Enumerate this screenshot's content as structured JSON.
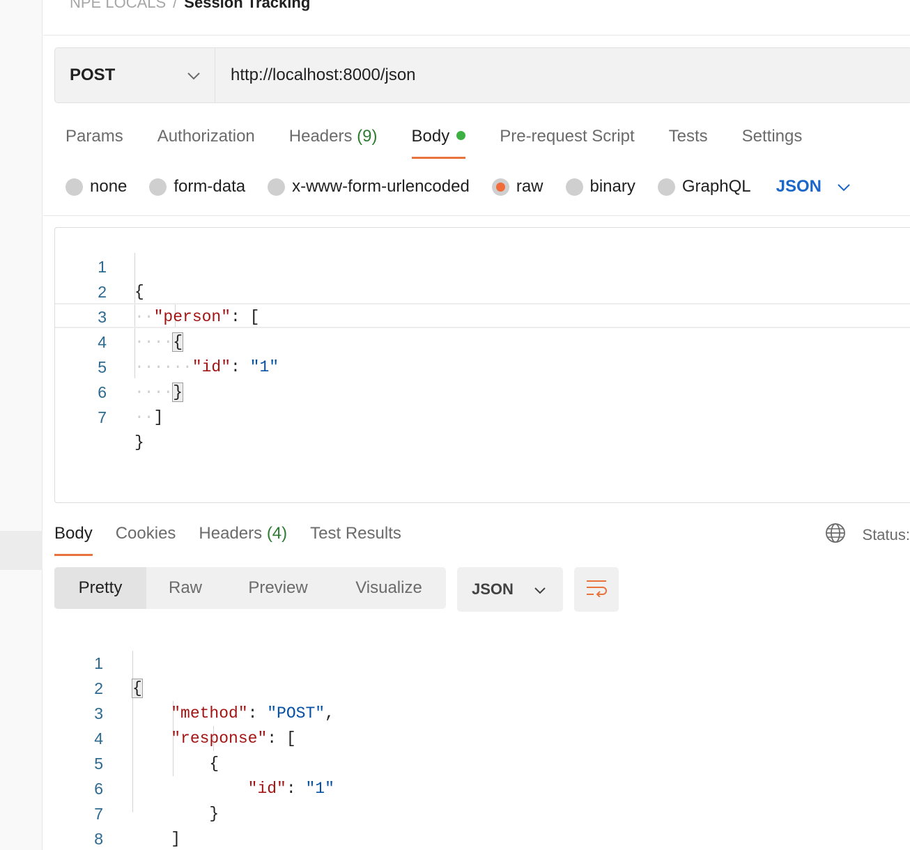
{
  "breadcrumb": {
    "parent": "NPE LOCALS",
    "separator": "/",
    "current": "Session Tracking"
  },
  "request": {
    "method": "POST",
    "url": "http://localhost:8000/json",
    "tabs": [
      {
        "label": "Params"
      },
      {
        "label": "Authorization"
      },
      {
        "label": "Headers",
        "count": "(9)"
      },
      {
        "label": "Body",
        "active": true
      },
      {
        "label": "Pre-request Script"
      },
      {
        "label": "Tests"
      },
      {
        "label": "Settings"
      }
    ],
    "body_types": [
      "none",
      "form-data",
      "x-www-form-urlencoded",
      "raw",
      "binary",
      "GraphQL"
    ],
    "selected_body_type": "raw",
    "body_language": "JSON",
    "body_lines": [
      {
        "n": "1",
        "text": "{"
      },
      {
        "n": "2",
        "key": "\"person\"",
        "rest": ": ["
      },
      {
        "n": "3",
        "text": "{"
      },
      {
        "n": "4",
        "key": "\"id\"",
        "value": "\"1\""
      },
      {
        "n": "5",
        "text": "}"
      },
      {
        "n": "6",
        "text": "]"
      },
      {
        "n": "7",
        "text": "}"
      }
    ]
  },
  "response": {
    "tabs": [
      {
        "label": "Body",
        "active": true
      },
      {
        "label": "Cookies"
      },
      {
        "label": "Headers",
        "count": "(4)"
      },
      {
        "label": "Test Results"
      }
    ],
    "status_label": "Status:",
    "view_modes": [
      "Pretty",
      "Raw",
      "Preview",
      "Visualize"
    ],
    "active_view_mode": "Pretty",
    "language": "JSON",
    "body_lines": [
      {
        "n": "1",
        "text": "{"
      },
      {
        "n": "2",
        "key": "\"method\"",
        "value": "\"POST\"",
        "trail": ","
      },
      {
        "n": "3",
        "key": "\"response\"",
        "rest": ": ["
      },
      {
        "n": "4",
        "text": "{"
      },
      {
        "n": "5",
        "key": "\"id\"",
        "value": "\"1\""
      },
      {
        "n": "6",
        "text": "}"
      },
      {
        "n": "7",
        "text": "]"
      },
      {
        "n": "8",
        "text": "}"
      }
    ]
  },
  "colors": {
    "accent": "#e8733d",
    "json_key": "#a31515",
    "json_string": "#0451a5",
    "link_blue": "#1a66c9",
    "count_green": "#2e7d32"
  }
}
